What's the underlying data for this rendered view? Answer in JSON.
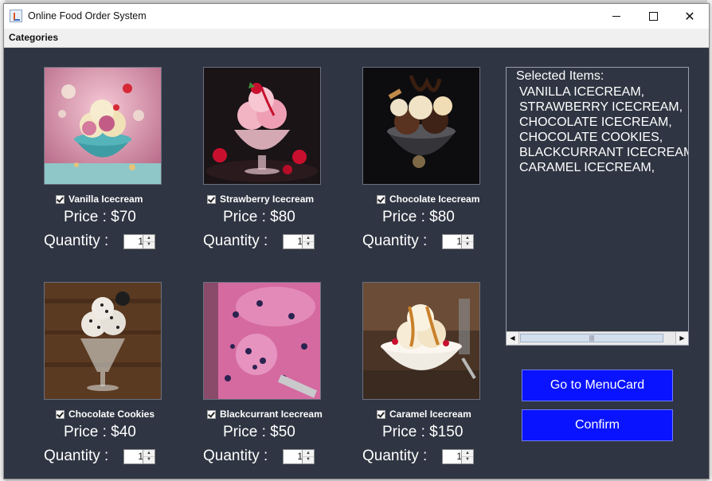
{
  "window": {
    "title": "Online Food Order System",
    "icon": "java-cup-icon"
  },
  "menubar": {
    "items": [
      "Categories"
    ]
  },
  "products": [
    {
      "name": "Vanilla Icecream",
      "price": "Price : $70",
      "quantity_label": "Quantity :",
      "quantity": "1",
      "checked": true,
      "image": "vanilla-icecream-photo"
    },
    {
      "name": "Strawberry Icecream",
      "price": "Price : $80",
      "quantity_label": "Quantity :",
      "quantity": "1",
      "checked": true,
      "image": "strawberry-icecream-photo"
    },
    {
      "name": "Chocolate Icecream",
      "price": "Price : $80",
      "quantity_label": "Quantity :",
      "quantity": "1",
      "checked": true,
      "image": "chocolate-icecream-photo"
    },
    {
      "name": "Chocolate Cookies",
      "price": "Price : $40",
      "quantity_label": "Quantity :",
      "quantity": "1",
      "checked": true,
      "image": "chocolate-cookies-photo"
    },
    {
      "name": "Blackcurrant Icecream",
      "price": "Price : $50",
      "quantity_label": "Quantity :",
      "quantity": "1",
      "checked": true,
      "image": "blackcurrant-icecream-photo"
    },
    {
      "name": "Caramel Icecream",
      "price": "Price : $150",
      "quantity_label": "Quantity :",
      "quantity": "1",
      "checked": true,
      "image": "caramel-icecream-photo"
    }
  ],
  "selected": {
    "title": "Selected Items:",
    "items": [
      "VANILLA ICECREAM,",
      "STRAWBERRY ICECREAM,",
      "CHOCOLATE ICECREAM,",
      "CHOCOLATE COOKIES,",
      "BLACKCURRANT ICECREAM",
      "CARAMEL ICECREAM,"
    ]
  },
  "buttons": {
    "menu": "Go to MenuCard",
    "confirm": "Confirm"
  },
  "colors": {
    "background": "#2f3542",
    "button": "#0a13ff",
    "text": "#ffffff"
  }
}
